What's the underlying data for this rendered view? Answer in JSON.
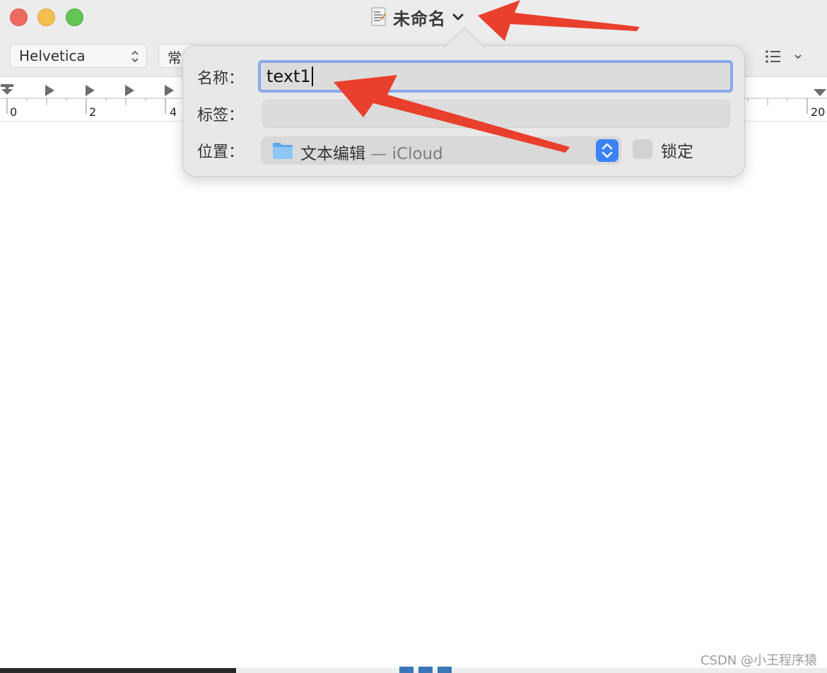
{
  "window": {
    "title": "未命名",
    "icons": {
      "document": "document-icon",
      "title_menu": "chevron-down-icon"
    }
  },
  "toolbar": {
    "font_family": "Helvetica",
    "font_style_partial": "常",
    "list_icon": "list-icon",
    "list_menu_icon": "chevron-down-icon"
  },
  "ruler": {
    "numbers": [
      "0",
      "2",
      "4",
      "20"
    ]
  },
  "save_popover": {
    "name_label": "名称：",
    "name_value": "text1",
    "tags_label": "标签：",
    "tags_value": "",
    "location_label": "位置：",
    "location_folder": "文本编辑",
    "location_separator": " — ",
    "location_service": "iCloud",
    "lock_label": "锁定",
    "lock_checked": false
  },
  "colors": {
    "focus_ring": "#8aa7e8",
    "stepper_blue": "#3b82f6",
    "annotation_red": "#e8402c",
    "traffic_red": "#ed6a5e",
    "traffic_yellow": "#f5bf4f",
    "traffic_green": "#62c554"
  },
  "watermark": "CSDN @小王程序猿"
}
